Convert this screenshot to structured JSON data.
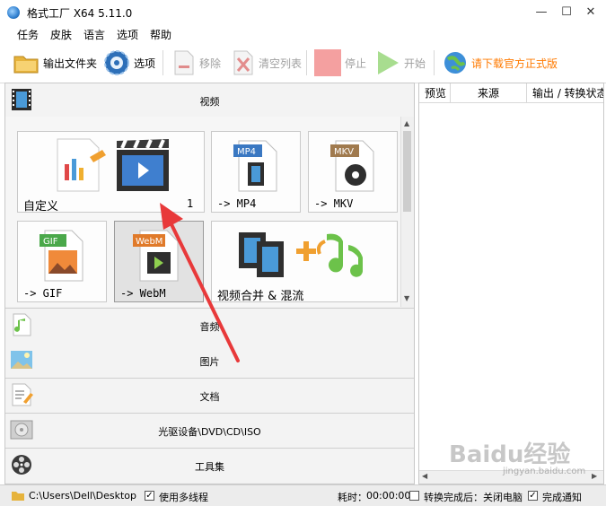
{
  "window": {
    "title": "格式工厂 X64 5.11.0",
    "minimize": "—",
    "maximize": "☐",
    "close": "✕"
  },
  "menu": [
    "任务",
    "皮肤",
    "语言",
    "选项",
    "帮助"
  ],
  "toolbar": {
    "output_folder": "输出文件夹",
    "options": "选项",
    "remove": "移除",
    "clear_list": "清空列表",
    "stop": "停止",
    "start": "开始",
    "download": "请下载官方正式版"
  },
  "categories": {
    "video": "视频",
    "audio": "音频",
    "image": "图片",
    "document": "文档",
    "disc": "光驱设备\\DVD\\CD\\ISO",
    "toolbox": "工具集"
  },
  "video_tiles": {
    "custom": {
      "label": "自定义",
      "count": "1"
    },
    "mp4": {
      "label": "-> MP4",
      "badge": "MP4"
    },
    "mkv": {
      "label": "-> MKV",
      "badge": "MKV"
    },
    "gif": {
      "label": "-> GIF",
      "badge": "GIF"
    },
    "webm": {
      "label": "-> WebM",
      "badge": "WebM"
    },
    "merge": {
      "label": "视频合并 & 混流"
    }
  },
  "task_columns": [
    "预览",
    "来源",
    "输出 / 转换状态"
  ],
  "status": {
    "path": "C:\\Users\\Dell\\Desktop",
    "multithread": "使用多线程",
    "elapsed_label": "耗时：",
    "elapsed": "00:00:00",
    "after_convert": "转换完成后：关闭电脑",
    "notify": "完成通知"
  },
  "watermark": {
    "brand": "Baidu经验",
    "site": "jingyan.baidu.com"
  },
  "colors": {
    "accent_orange": "#ff8a00",
    "stop_red": "#f08080",
    "start_green": "#6cc24a",
    "arrow_red": "#e8393a"
  }
}
